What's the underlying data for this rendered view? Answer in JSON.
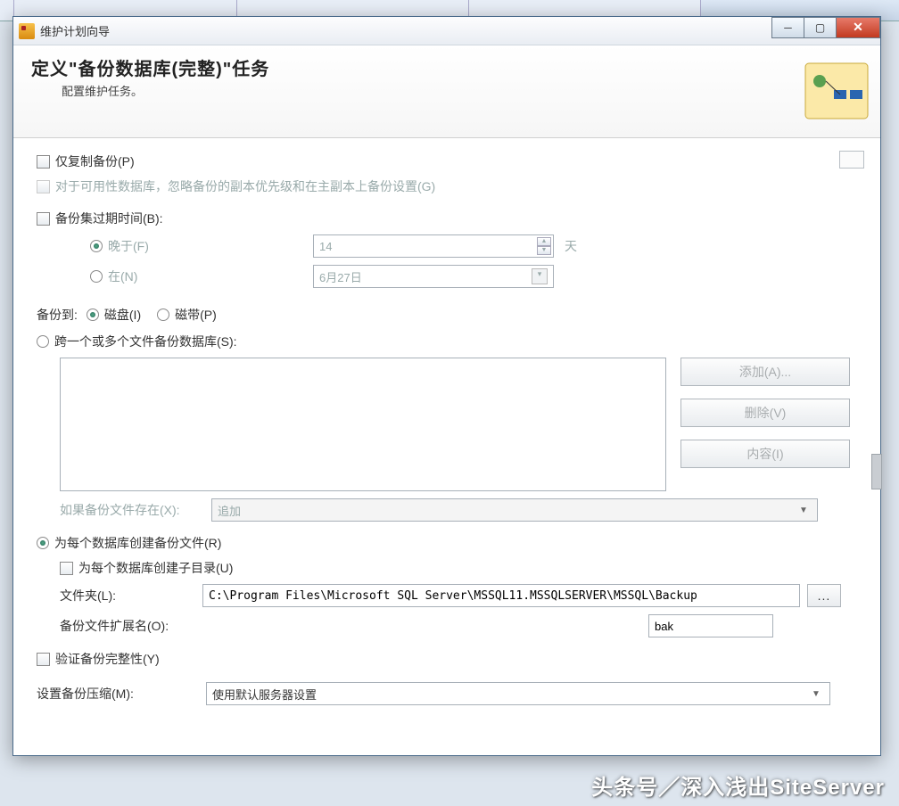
{
  "browserTabs": [
    "",
    "",
    "",
    ""
  ],
  "window": {
    "title": "维护计划向导",
    "header_title": "定义\"备份数据库(完整)\"任务",
    "header_sub": "配置维护任务。"
  },
  "form": {
    "copy_only": "仅复制备份(P)",
    "availability_ignore": "对于可用性数据库，忽略备份的副本优先级和在主副本上备份设置(G)",
    "expire_label": "备份集过期时间(B):",
    "expire_after": "晚于(F)",
    "expire_days_value": "14",
    "expire_days_unit": "天",
    "expire_on": "在(N)",
    "expire_date": "6月27日",
    "backup_to": "备份到:",
    "to_disk": "磁盘(I)",
    "to_tape": "磁带(P)",
    "span_files": "跨一个或多个文件备份数据库(S):",
    "add_btn": "添加(A)...",
    "remove_btn": "删除(V)",
    "contents_btn": "内容(I)",
    "if_exists_label": "如果备份文件存在(X):",
    "if_exists_value": "追加",
    "per_db": "为每个数据库创建备份文件(R)",
    "per_db_subdir": "为每个数据库创建子目录(U)",
    "folder_label": "文件夹(L):",
    "folder_value": "C:\\Program Files\\Microsoft SQL Server\\MSSQL11.MSSQLSERVER\\MSSQL\\Backup",
    "ext_label": "备份文件扩展名(O):",
    "ext_value": "bak",
    "verify": "验证备份完整性(Y)",
    "compress_label": "设置备份压缩(M):",
    "compress_value": "使用默认服务器设置"
  },
  "watermark": "头条号／深入浅出SiteServer"
}
